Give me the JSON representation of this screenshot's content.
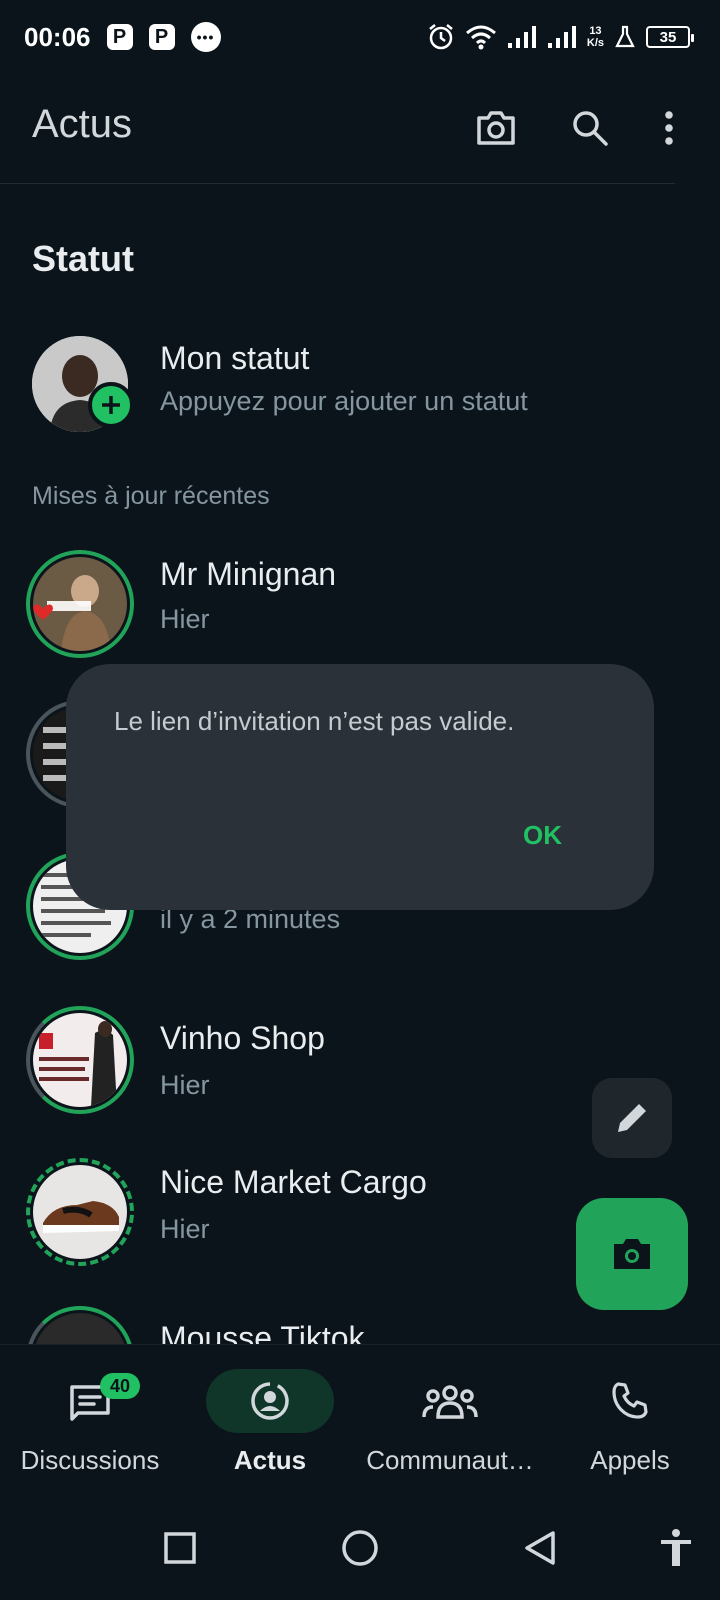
{
  "status_bar": {
    "time": "00:06",
    "app_icon_1": "P",
    "app_icon_2": "P",
    "messenger_icon": "•••",
    "net_speed_value": "13",
    "net_speed_unit": "K/s",
    "battery": "35"
  },
  "app_bar": {
    "title": "Actus"
  },
  "status_section": {
    "title": "Statut",
    "my_status": {
      "name": "Mon statut",
      "subtitle": "Appuyez pour ajouter un statut"
    },
    "recent_label": "Mises à jour récentes",
    "items": [
      {
        "name": "Mr Minignan",
        "time": "Hier",
        "ring": "seen-partial"
      },
      {
        "name": "",
        "time": "",
        "ring": "grey"
      },
      {
        "name": "",
        "time": "il y a 2 minutes",
        "ring": "green"
      },
      {
        "name": "Vinho Shop",
        "time": "Hier",
        "ring": "green-partial"
      },
      {
        "name": "Nice Market Cargo",
        "time": "Hier",
        "ring": "dashed"
      },
      {
        "name": "Mousse Tiktok",
        "time": "",
        "ring": "green-partial"
      }
    ]
  },
  "dialog": {
    "message": "Le lien d’invitation n’est pas valide.",
    "ok_label": "OK"
  },
  "bottom_nav": {
    "items": [
      {
        "label": "Discussions",
        "icon": "chat-icon",
        "badge": "40"
      },
      {
        "label": "Actus",
        "icon": "updates-icon",
        "active": true
      },
      {
        "label": "Communaut…",
        "icon": "communities-icon"
      },
      {
        "label": "Appels",
        "icon": "phone-icon"
      }
    ]
  },
  "colors": {
    "background": "#0b141a",
    "accent": "#21c063",
    "fab": "#21a45a",
    "dialog": "#2a3138"
  }
}
